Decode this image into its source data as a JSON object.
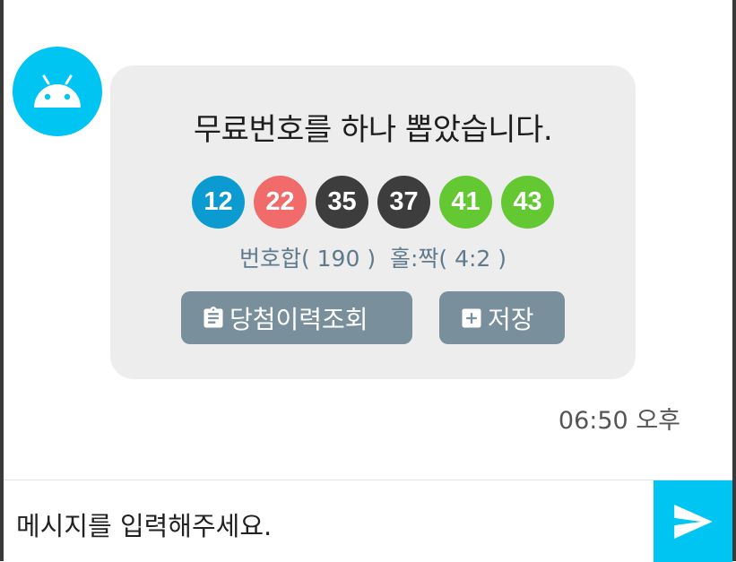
{
  "message": {
    "text": "무료번호를 하나 뽑았습니다.",
    "numbers": [
      {
        "value": "12",
        "color": "#0b9bd1"
      },
      {
        "value": "22",
        "color": "#f26b6b"
      },
      {
        "value": "35",
        "color": "#3d3d3d"
      },
      {
        "value": "37",
        "color": "#3d3d3d"
      },
      {
        "value": "41",
        "color": "#63c832"
      },
      {
        "value": "43",
        "color": "#63c832"
      }
    ],
    "stats": "번호합( 190 )  홀:짝( 4:2 )",
    "history_button": {
      "label": "당첨이력조회",
      "icon": "clipboard-icon"
    },
    "save_button": {
      "label": "저장",
      "icon": "plus-box-icon"
    },
    "timestamp": "06:50 오후"
  },
  "avatar": {
    "icon": "android-icon",
    "color": "#00c4f2"
  },
  "input": {
    "placeholder": "메시지를 입력해주세요."
  },
  "send_button": {
    "icon": "send-icon",
    "color": "#00c4f2"
  }
}
